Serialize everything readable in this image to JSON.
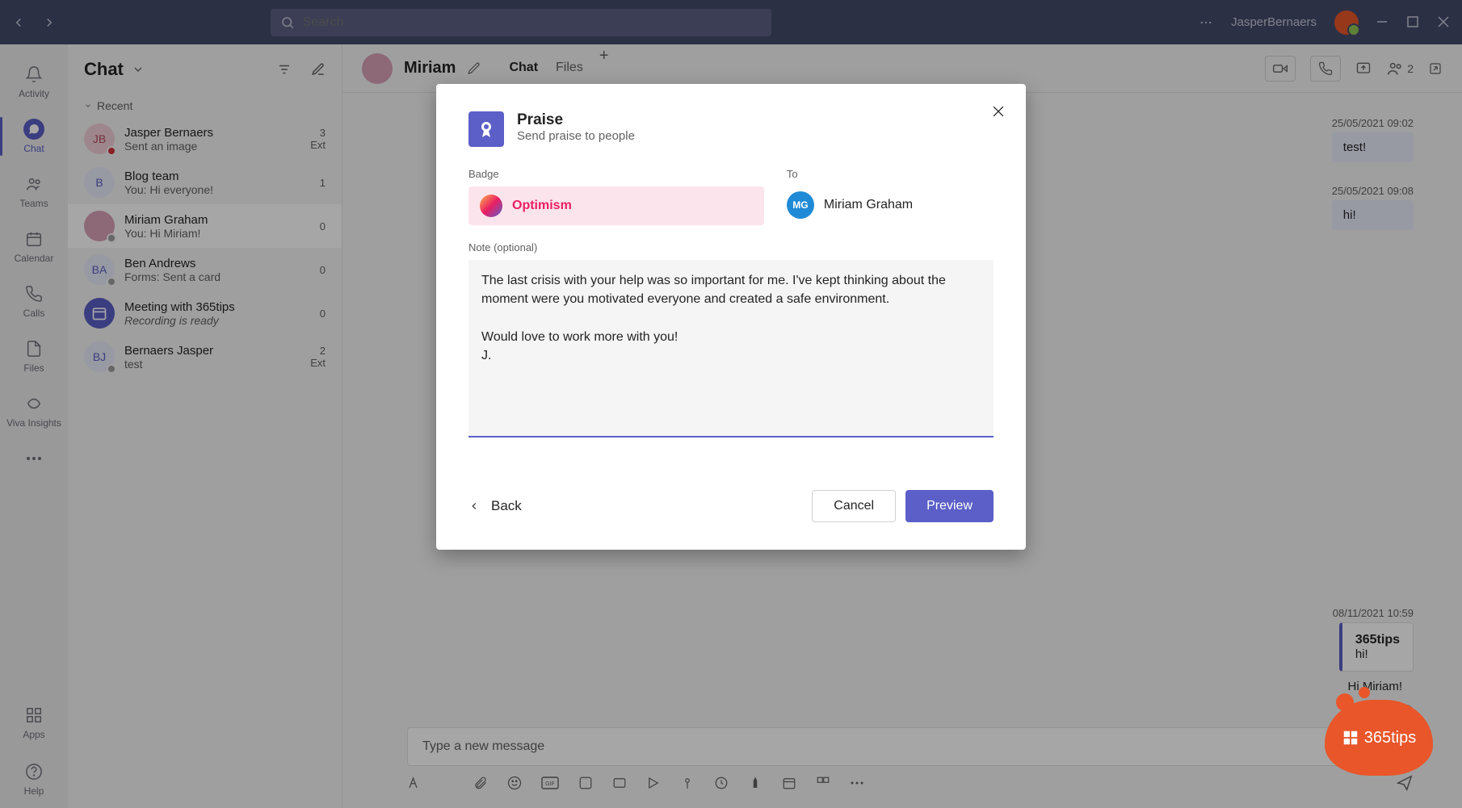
{
  "titlebar": {
    "search_placeholder": "Search",
    "username": "JasperBernaers"
  },
  "rail": {
    "activity": "Activity",
    "chat": "Chat",
    "teams": "Teams",
    "calendar": "Calendar",
    "calls": "Calls",
    "files": "Files",
    "viva": "Viva Insights",
    "apps": "Apps",
    "help": "Help"
  },
  "chatlist": {
    "title": "Chat",
    "recent": "Recent",
    "items": [
      {
        "initials": "JB",
        "name": "Jasper Bernaers",
        "sub": "Sent an image",
        "time": "3",
        "tag": "Ext",
        "avatar_bg": "#f3d0d7",
        "avatar_fg": "#b24a5e",
        "presence": "#d13438"
      },
      {
        "initials": "B",
        "name": "Blog team",
        "sub": "You: Hi everyone!",
        "time": "1",
        "tag": "",
        "avatar_bg": "#e8ebfa",
        "avatar_fg": "#5b5fc7",
        "presence": ""
      },
      {
        "initials": "",
        "name": "Miriam Graham",
        "sub": "You: Hi Miriam!",
        "time": "0",
        "tag": "",
        "avatar_bg": "#d9a0b5",
        "avatar_fg": "#fff",
        "presence": "#9e9e9e",
        "selected": true,
        "photo": true
      },
      {
        "initials": "BA",
        "name": "Ben Andrews",
        "sub": "Forms: Sent a card",
        "time": "0",
        "tag": "",
        "avatar_bg": "#e8ebfa",
        "avatar_fg": "#5b5fc7",
        "presence": "#9e9e9e"
      },
      {
        "initials": "",
        "name": "Meeting with 365tips",
        "sub": "Recording is ready",
        "time": "0",
        "tag": "",
        "avatar_bg": "#5b5fc7",
        "avatar_fg": "#fff",
        "presence": "",
        "italic": true,
        "icon": "cal"
      },
      {
        "initials": "BJ",
        "name": "Bernaers Jasper",
        "sub": "test",
        "time": "2",
        "tag": "Ext",
        "avatar_bg": "#e8ebfa",
        "avatar_fg": "#5b5fc7",
        "presence": "#9e9e9e"
      }
    ]
  },
  "conversation": {
    "name": "Miriam",
    "tabs": {
      "chat": "Chat",
      "files": "Files"
    },
    "participants": "2",
    "messages": [
      {
        "time": "25/05/2021 09:02",
        "text": "test!"
      },
      {
        "time": "25/05/2021 09:08",
        "text": "hi!"
      }
    ],
    "card": {
      "time": "08/11/2021 10:59",
      "title": "365tips",
      "text": "hi!"
    },
    "last_msg": "Hi Miriam!",
    "compose_placeholder": "Type a new message"
  },
  "modal": {
    "title": "Praise",
    "subtitle": "Send praise to people",
    "badge_label": "Badge",
    "badge_name": "Optimism",
    "to_label": "To",
    "to_initials": "MG",
    "to_name": "Miriam Graham",
    "note_label": "Note (optional)",
    "note_text": "The last crisis with your help was so important for me. I've kept thinking about the moment were you motivated everyone and created a safe environment.\n\nWould love to work more with you!\nJ.",
    "back": "Back",
    "cancel": "Cancel",
    "preview": "Preview"
  },
  "brand": "365tips"
}
